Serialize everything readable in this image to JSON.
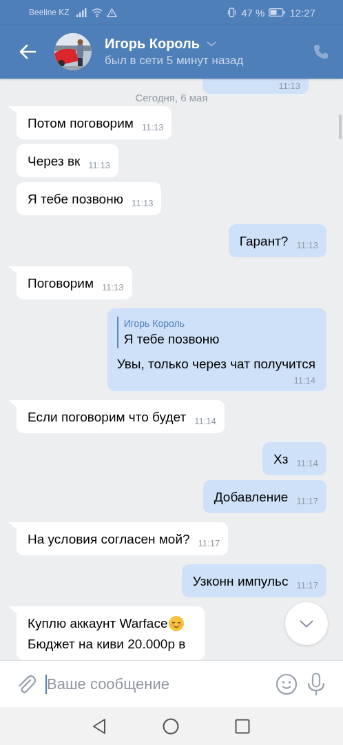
{
  "status_bar": {
    "carrier": "Beeline KZ",
    "battery": "47 %",
    "time": "12:27"
  },
  "header": {
    "name": "Игорь Король",
    "status": "был в сети 5 минут назад"
  },
  "messages": [
    {
      "kind": "outgoing",
      "time": "11:13",
      "tail": false
    },
    {
      "kind": "date",
      "text": "Сегодня, 6 мая"
    },
    {
      "kind": "incoming",
      "text": "Потом поговорим",
      "time": "11:13",
      "tail": true
    },
    {
      "kind": "incoming",
      "text": "Через вк",
      "time": "11:13",
      "tail": false
    },
    {
      "kind": "incoming",
      "text": "Я тебе позвоню",
      "time": "11:13",
      "tail": false
    },
    {
      "kind": "outgoing",
      "text": "Гарант?",
      "time": "11:13",
      "tail": false
    },
    {
      "kind": "incoming",
      "text": "Поговорим",
      "time": "11:13",
      "tail": true
    },
    {
      "kind": "outgoing",
      "reply": {
        "author": "Игорь Король",
        "text": "Я тебе позвоню"
      },
      "text": "Увы, только через чат получится",
      "time": "11:14",
      "tail": false
    },
    {
      "kind": "incoming",
      "text": "Если поговорим что будет",
      "time": "11:14",
      "tail": true
    },
    {
      "kind": "outgoing",
      "text": "Хз",
      "time": "11:14",
      "tail": false
    },
    {
      "kind": "outgoing",
      "text": "Добавление",
      "time": "11:17",
      "tail": false
    },
    {
      "kind": "incoming",
      "text": "На условия согласен мой?",
      "time": "11:17",
      "tail": true
    },
    {
      "kind": "outgoing",
      "text": "Узконн импульс",
      "time": "11:17",
      "tail": false
    },
    {
      "kind": "incoming",
      "lines": [
        {
          "text": "Куплю аккаунт Warface",
          "emoji": true
        },
        {
          "text": "Бюджет на киви 20.000р в",
          "emoji": false
        }
      ],
      "tail": true
    }
  ],
  "composer": {
    "placeholder": "Ваше сообщение"
  }
}
